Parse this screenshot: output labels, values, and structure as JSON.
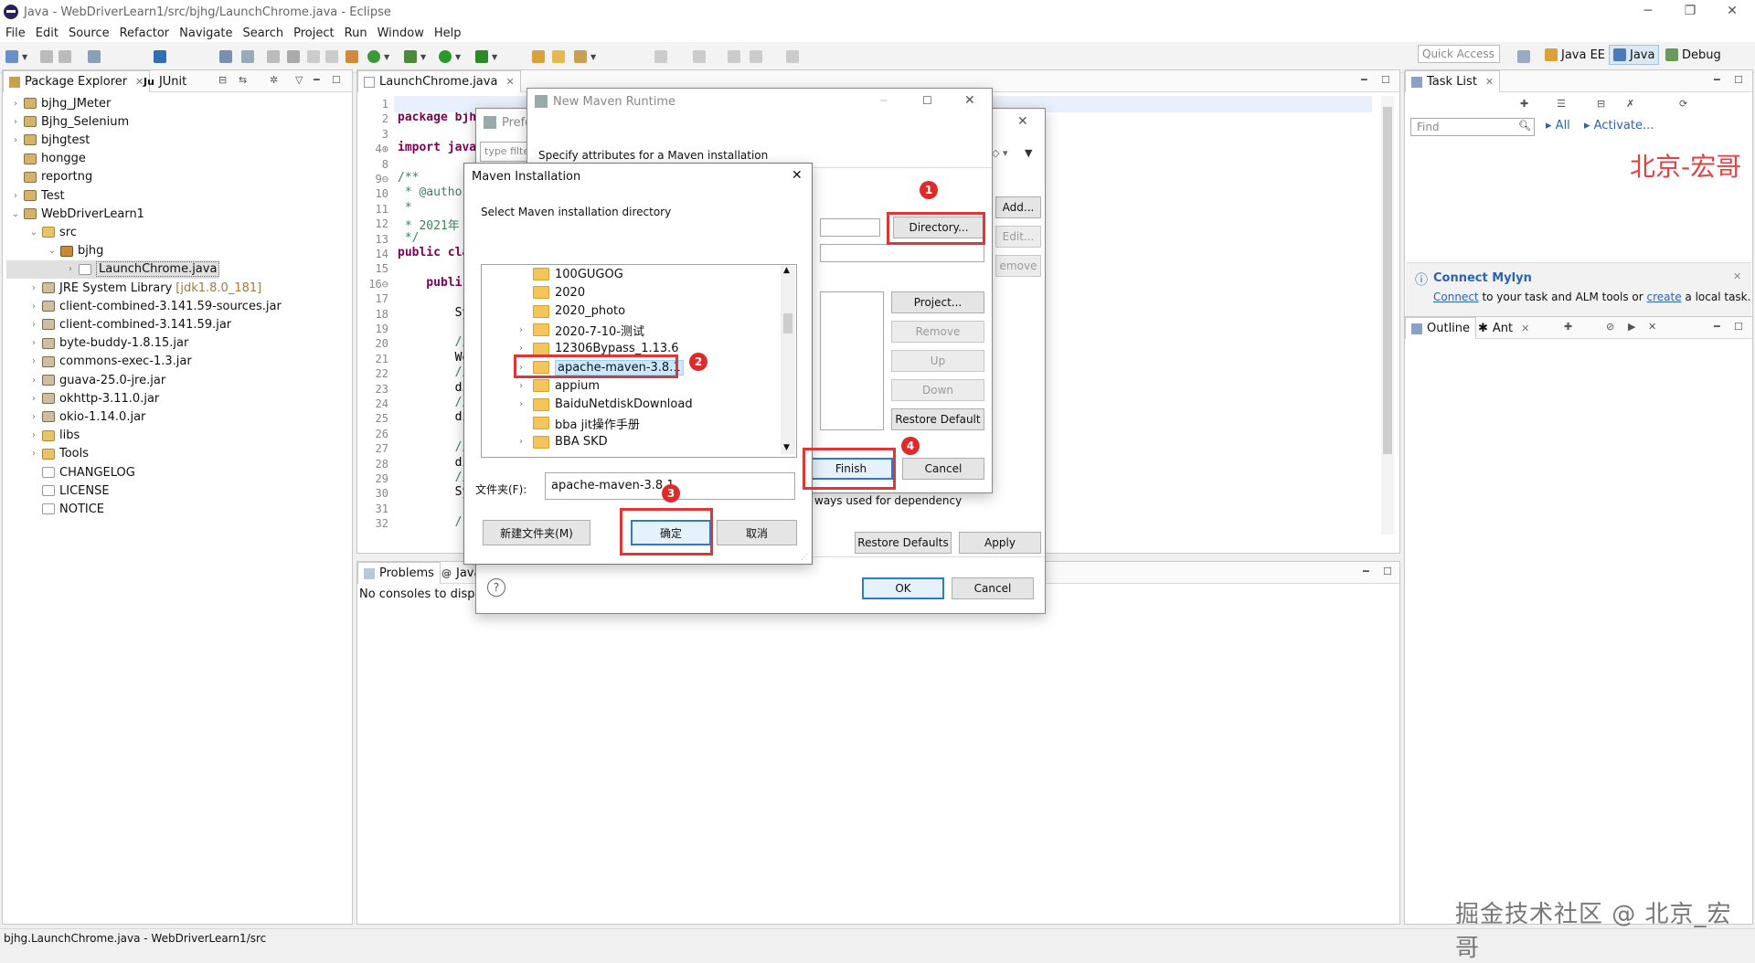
{
  "window": {
    "title": "Java - WebDriverLearn1/src/bjhg/LaunchChrome.java - Eclipse",
    "minimize": "─",
    "restore": "❐",
    "close": "✕"
  },
  "menu": [
    "File",
    "Edit",
    "Source",
    "Refactor",
    "Navigate",
    "Search",
    "Project",
    "Run",
    "Window",
    "Help"
  ],
  "toolbar": {
    "quick_access": "Quick Access",
    "perspectives": [
      "Java EE",
      "Java",
      "Debug"
    ]
  },
  "package_explorer": {
    "tabs": [
      "Package Explorer",
      "JUnit"
    ],
    "items": [
      {
        "label": "bjhg_JMeter",
        "depth": 0,
        "expander": "›",
        "icon": "proj"
      },
      {
        "label": "Bjhg_Selenium",
        "depth": 0,
        "expander": "›",
        "icon": "proj"
      },
      {
        "label": "bjhgtest",
        "depth": 0,
        "expander": "›",
        "icon": "proj"
      },
      {
        "label": "hongge",
        "depth": 0,
        "expander": "",
        "icon": "proj"
      },
      {
        "label": "reportng",
        "depth": 0,
        "expander": "",
        "icon": "proj"
      },
      {
        "label": "Test",
        "depth": 0,
        "expander": "›",
        "icon": "proj"
      },
      {
        "label": "WebDriverLearn1",
        "depth": 0,
        "expander": "⌄",
        "icon": "proj"
      },
      {
        "label": "src",
        "depth": 1,
        "expander": "⌄",
        "icon": "folder"
      },
      {
        "label": "bjhg",
        "depth": 2,
        "expander": "⌄",
        "icon": "pkg"
      },
      {
        "label": "LaunchChrome.java",
        "depth": 3,
        "expander": "›",
        "icon": "file",
        "selected": true
      },
      {
        "label": "JRE System Library",
        "suffix": "[jdk1.8.0_181]",
        "depth": 1,
        "expander": "›",
        "icon": "jar"
      },
      {
        "label": "client-combined-3.141.59-sources.jar",
        "depth": 1,
        "expander": "›",
        "icon": "jar"
      },
      {
        "label": "client-combined-3.141.59.jar",
        "depth": 1,
        "expander": "›",
        "icon": "jar"
      },
      {
        "label": "byte-buddy-1.8.15.jar",
        "depth": 1,
        "expander": "›",
        "icon": "jar"
      },
      {
        "label": "commons-exec-1.3.jar",
        "depth": 1,
        "expander": "›",
        "icon": "jar"
      },
      {
        "label": "guava-25.0-jre.jar",
        "depth": 1,
        "expander": "›",
        "icon": "jar"
      },
      {
        "label": "okhttp-3.11.0.jar",
        "depth": 1,
        "expander": "›",
        "icon": "jar"
      },
      {
        "label": "okio-1.14.0.jar",
        "depth": 1,
        "expander": "›",
        "icon": "jar"
      },
      {
        "label": "libs",
        "depth": 1,
        "expander": "›",
        "icon": "folder"
      },
      {
        "label": "Tools",
        "depth": 1,
        "expander": "›",
        "icon": "folder"
      },
      {
        "label": "CHANGELOG",
        "depth": 1,
        "expander": "",
        "icon": "file"
      },
      {
        "label": "LICENSE",
        "depth": 1,
        "expander": "",
        "icon": "file"
      },
      {
        "label": "NOTICE",
        "depth": 1,
        "expander": "",
        "icon": "file"
      }
    ]
  },
  "editor": {
    "tab": "LaunchChrome.java",
    "line_numbers": [
      "1",
      "2",
      "3",
      "4⊕",
      "8",
      "9⊖",
      "10",
      "11",
      "12",
      "13",
      "14",
      "15",
      "16⊖",
      "17",
      "18",
      "19",
      "20",
      "21",
      "22",
      "23",
      "24",
      "25",
      "26",
      "27",
      "28",
      "29",
      "30",
      "31",
      "32"
    ],
    "code": [
      {
        "line": 1,
        "text": ""
      },
      {
        "line": 2,
        "text": "package bjh",
        "kw": "package"
      },
      {
        "line": 3,
        "text": ""
      },
      {
        "line": 4,
        "text": "import java",
        "kw": "import"
      },
      {
        "line": 5,
        "text": ""
      },
      {
        "line": 6,
        "text": "/**",
        "cm": true
      },
      {
        "line": 7,
        "text": " * @autho",
        "cm": true
      },
      {
        "line": 8,
        "text": " *",
        "cm": true
      },
      {
        "line": 9,
        "text": " * 2021年",
        "cm": true
      },
      {
        "line": 10,
        "text": " */",
        "cm": true
      },
      {
        "line": 11,
        "text": "public cla",
        "kw": "public"
      },
      {
        "line": 12,
        "text": ""
      },
      {
        "line": 13,
        "text": "    publi",
        "kw": "publi"
      },
      {
        "line": 14,
        "text": ""
      },
      {
        "line": 15,
        "text": "        Sy"
      },
      {
        "line": 16,
        "text": ""
      },
      {
        "line": 17,
        "text": "        //",
        "cm": true
      },
      {
        "line": 18,
        "text": "        We"
      },
      {
        "line": 19,
        "text": "        //",
        "cm": true
      },
      {
        "line": 20,
        "text": "        di"
      },
      {
        "line": 21,
        "text": "        //",
        "cm": true
      },
      {
        "line": 22,
        "text": "        di"
      },
      {
        "line": 23,
        "text": ""
      },
      {
        "line": 24,
        "text": "        //",
        "cm": true
      },
      {
        "line": 25,
        "text": "        di"
      },
      {
        "line": 26,
        "text": "        //",
        "cm": true
      },
      {
        "line": 27,
        "text": "        Sy"
      },
      {
        "line": 28,
        "text": ""
      },
      {
        "line": 29,
        "text": "        /",
        "cm": true
      }
    ]
  },
  "console": {
    "tabs": [
      "Problems",
      "Java"
    ],
    "message": "No consoles to displa"
  },
  "task_list": {
    "tab": "Task List",
    "find_placeholder": "Find",
    "filter_all": "All",
    "activate": "Activate...",
    "watermark_top": "北京-宏哥"
  },
  "mylyn": {
    "title": "Connect Mylyn",
    "connect": "Connect",
    "text1": " to your task and ALM tools or ",
    "create": "create",
    "text2": " a local task."
  },
  "outline": {
    "tabs": [
      "Outline",
      "Ant"
    ]
  },
  "preferences_dialog": {
    "title": "Prefe",
    "filter_placeholder": "type filte",
    "restore_defaults": "Restore Defaults",
    "apply": "Apply",
    "ok": "OK",
    "cancel": "Cancel",
    "bottom_text": "ways used for dependency",
    "help": "?"
  },
  "runtime_dialog": {
    "title": "New Maven Runtime",
    "subtitle": "Specify attributes for a Maven installation",
    "add": "Add...",
    "edit": "Edit...",
    "remove_side": "emove",
    "directory": "Directory...",
    "project": "Project...",
    "remove": "Remove",
    "up": "Up",
    "down": "Down",
    "restore_default": "Restore Default",
    "finish": "Finish",
    "cancel": "Cancel"
  },
  "folder_dialog": {
    "title": "Maven Installation",
    "close": "✕",
    "instruction": "Select Maven installation directory",
    "folders": [
      {
        "name": "100GUGOG",
        "expander": ""
      },
      {
        "name": "2020",
        "expander": ""
      },
      {
        "name": "2020_photo",
        "expander": ""
      },
      {
        "name": "2020-7-10-测试",
        "expander": "›"
      },
      {
        "name": "12306Bypass_1.13.6",
        "expander": "›"
      },
      {
        "name": "apache-maven-3.8.1",
        "expander": "›",
        "selected": true
      },
      {
        "name": "appium",
        "expander": "›"
      },
      {
        "name": "BaiduNetdiskDownload",
        "expander": "›"
      },
      {
        "name": "bba jit操作手册",
        "expander": ""
      },
      {
        "name": "BBA SKD",
        "expander": "›"
      }
    ],
    "folder_label": "文件夹(F):",
    "folder_value": "apache-maven-3.8.1",
    "new_folder": "新建文件夹(M)",
    "ok": "确定",
    "cancel": "取消"
  },
  "annotations": [
    "1",
    "2",
    "3",
    "4"
  ],
  "status_bar": "bjhg.LaunchChrome.java - WebDriverLearn1/src",
  "watermark_bottom": "掘金技术社区 @ 北京_宏哥"
}
